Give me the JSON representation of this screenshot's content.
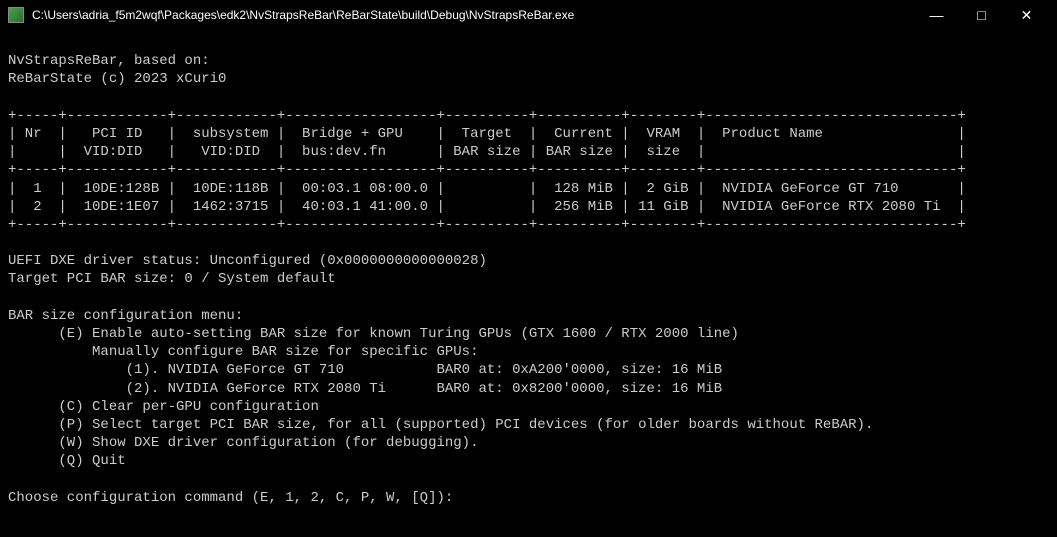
{
  "titleBar": {
    "title": "C:\\Users\\adria_f5m2wqf\\Packages\\edk2\\NvStrapsReBar\\ReBarState\\build\\Debug\\NvStrapsReBar.exe",
    "minimize": "—",
    "maximize": "□",
    "close": "✕"
  },
  "header": {
    "line1": "NvStrapsReBar, based on:",
    "line2": "ReBarState (c) 2023 xCuri0"
  },
  "table": {
    "border": "+-----+------------+------------+------------------+----------+----------+--------+------------------------------+",
    "headerRow1": "| Nr  |   PCI ID   |  subsystem |  Bridge + GPU    |  Target  |  Current |  VRAM  |  Product Name                |",
    "headerRow2": "|     |  VID:DID   |   VID:DID  |  bus:dev.fn      | BAR size | BAR size |  size  |                              |",
    "dataRow1": "|  1  |  10DE:128B |  10DE:118B |  00:03.1 08:00.0 |          |  128 MiB |  2 GiB |  NVIDIA GeForce GT 710       |",
    "dataRow2": "|  2  |  10DE:1E07 |  1462:3715 |  40:03.1 41:00.0 |          |  256 MiB | 11 GiB |  NVIDIA GeForce RTX 2080 Ti  |"
  },
  "status": {
    "line1": "UEFI DXE driver status: Unconfigured (0x0000000000000028)",
    "line2": "Target PCI BAR size: 0 / System default"
  },
  "menu": {
    "title": "BAR size configuration menu:",
    "optionE": "      (E) Enable auto-setting BAR size for known Turing GPUs (GTX 1600 / RTX 2000 line)",
    "manualHeader": "          Manually configure BAR size for specific GPUs:",
    "option1": "              (1). NVIDIA GeForce GT 710           BAR0 at: 0xA200'0000, size: 16 MiB",
    "option2": "              (2). NVIDIA GeForce RTX 2080 Ti      BAR0 at: 0x8200'0000, size: 16 MiB",
    "optionC": "      (C) Clear per-GPU configuration",
    "optionP": "      (P) Select target PCI BAR size, for all (supported) PCI devices (for older boards without ReBAR).",
    "optionW": "      (W) Show DXE driver configuration (for debugging).",
    "optionQ": "      (Q) Quit"
  },
  "prompt": {
    "text": "Choose configuration command (E, 1, 2, C, P, W, [Q]):"
  }
}
